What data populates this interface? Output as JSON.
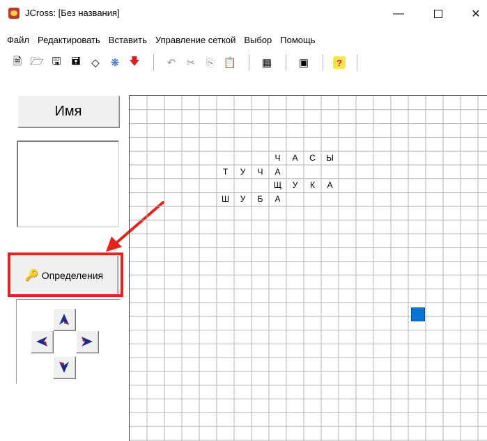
{
  "window": {
    "title": "JCross: [Без названия]",
    "controls": {
      "minimize": "—",
      "close": "✕"
    }
  },
  "menubar": {
    "items": [
      {
        "label": "Файл"
      },
      {
        "label": "Редактировать"
      },
      {
        "label": "Вставить"
      },
      {
        "label": "Управление сеткой"
      },
      {
        "label": "Выбор"
      },
      {
        "label": "Помощь"
      }
    ]
  },
  "toolbar": {
    "buttons": [
      {
        "icon": "new-file-icon",
        "glyph": "🗎"
      },
      {
        "icon": "open-folder-icon",
        "glyph": "🗁"
      },
      {
        "icon": "save-icon",
        "glyph": "🖫"
      },
      {
        "icon": "save-as-icon",
        "glyph": "🖬"
      },
      {
        "icon": "eraser-icon",
        "glyph": "◇"
      },
      {
        "icon": "web-export-icon",
        "glyph": "❋"
      },
      {
        "icon": "insert-down-icon",
        "glyph": "🡇"
      },
      {
        "icon": "undo-icon",
        "glyph": "↶"
      },
      {
        "icon": "cut-icon",
        "glyph": "✂"
      },
      {
        "icon": "copy-icon",
        "glyph": "⎘"
      },
      {
        "icon": "paste-icon",
        "glyph": "📋"
      },
      {
        "icon": "grid-icon",
        "glyph": "▦"
      },
      {
        "icon": "view-icon",
        "glyph": "▣"
      },
      {
        "icon": "help-icon",
        "glyph": "?"
      }
    ]
  },
  "left_panel": {
    "name_button": "Имя",
    "definitions_button": "Определения"
  },
  "grid": {
    "letters": [
      {
        "row": 4,
        "col": 8,
        "ch": "Ч"
      },
      {
        "row": 4,
        "col": 9,
        "ch": "А"
      },
      {
        "row": 4,
        "col": 10,
        "ch": "С"
      },
      {
        "row": 4,
        "col": 11,
        "ch": "Ы"
      },
      {
        "row": 5,
        "col": 5,
        "ch": "Т"
      },
      {
        "row": 5,
        "col": 6,
        "ch": "У"
      },
      {
        "row": 5,
        "col": 7,
        "ch": "Ч"
      },
      {
        "row": 5,
        "col": 8,
        "ch": "А"
      },
      {
        "row": 6,
        "col": 8,
        "ch": "Щ"
      },
      {
        "row": 6,
        "col": 9,
        "ch": "У"
      },
      {
        "row": 6,
        "col": 10,
        "ch": "К"
      },
      {
        "row": 6,
        "col": 11,
        "ch": "А"
      },
      {
        "row": 7,
        "col": 5,
        "ch": "Ш"
      },
      {
        "row": 7,
        "col": 6,
        "ch": "У"
      },
      {
        "row": 7,
        "col": 7,
        "ch": "Б"
      },
      {
        "row": 7,
        "col": 8,
        "ch": "А"
      }
    ],
    "cursor_color": "#0a74d6"
  },
  "colors": {
    "highlight": "#e8221b",
    "nav_arrow_fill": "#1b2a8c",
    "nav_arrow_accent": "#d62020"
  }
}
